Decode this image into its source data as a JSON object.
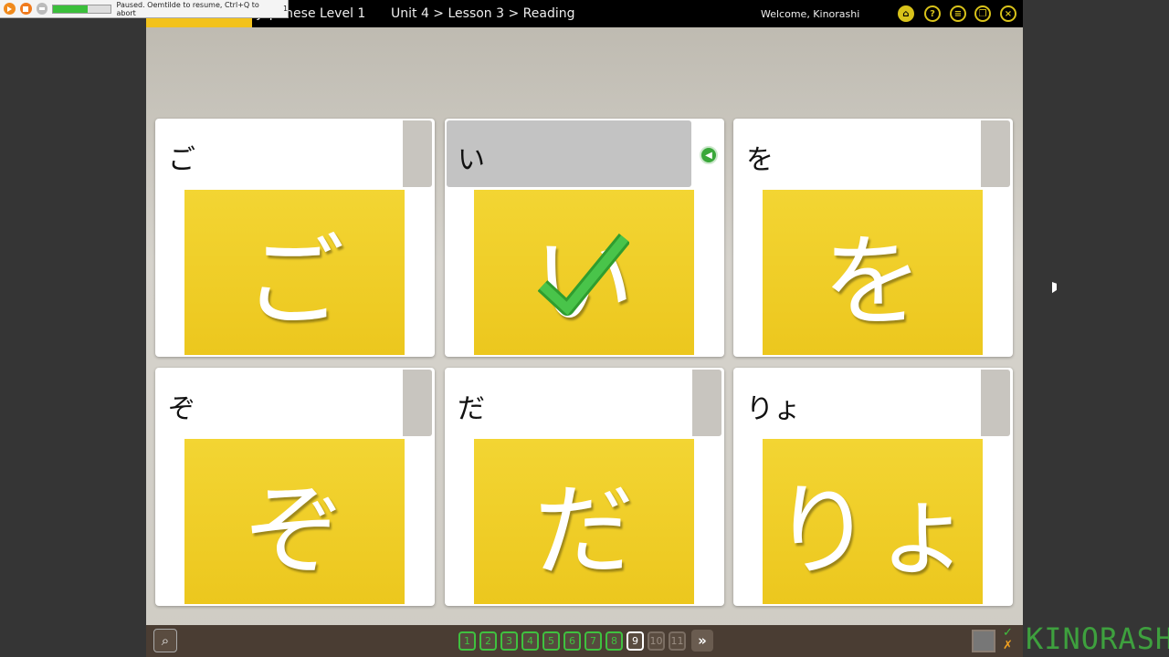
{
  "recorder": {
    "status": "Paused. Oemtilde to resume, Ctrl+Q to abort",
    "count": "1",
    "progress": 0.6
  },
  "header": {
    "course": "Japanese Level 1",
    "breadcrumb": "Unit 4 > Lesson 3 > Reading",
    "welcome": "Welcome, Kinorashi",
    "icons": [
      "home-icon",
      "help-icon",
      "menu-icon",
      "window-icon",
      "close-icon"
    ]
  },
  "cards": [
    {
      "label": "ご",
      "image": "ご",
      "selected": false
    },
    {
      "label": "い",
      "image": "い",
      "selected": true,
      "correct": true
    },
    {
      "label": "を",
      "image": "を",
      "selected": false
    },
    {
      "label": "ぞ",
      "image": "ぞ",
      "selected": false
    },
    {
      "label": "だ",
      "image": "だ",
      "selected": false
    },
    {
      "label": "りょ",
      "image": "りょ",
      "selected": false
    }
  ],
  "pagination": {
    "pages": [
      "1",
      "2",
      "3",
      "4",
      "5",
      "6",
      "7",
      "8",
      "9",
      "10",
      "11"
    ],
    "completed": 8,
    "current": "9",
    "next": "»"
  },
  "watermark": "KINORASHI",
  "colors": {
    "accent": "#d8c21a",
    "done": "#3fc13f",
    "card_image": "#f0cf2a"
  }
}
